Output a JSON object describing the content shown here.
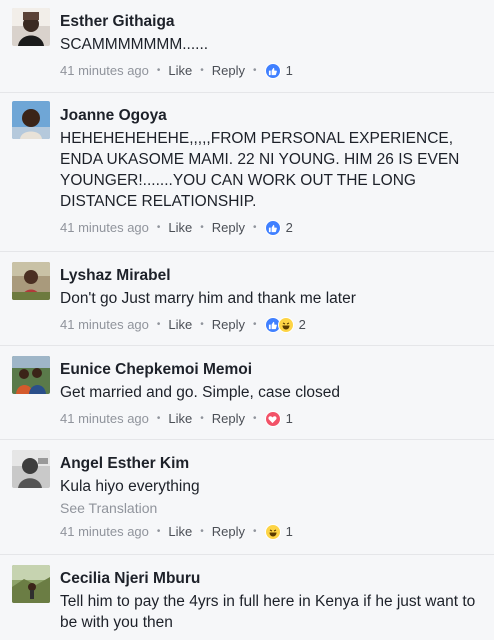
{
  "comments": [
    {
      "name": "Esther Githaiga",
      "text": "SCAMMMMMMM......",
      "time": "41 minutes ago",
      "like": "Like",
      "reply": "Reply",
      "reactions": [
        "like"
      ],
      "count": "1",
      "see_translation": ""
    },
    {
      "name": "Joanne Ogoya",
      "text": "HEHEHEHEHEHE,,,,,FROM PERSONAL EXPERIENCE, ENDA UKASOME MAMI. 22 NI YOUNG. HIM 26 IS EVEN YOUNGER!.......YOU CAN WORK OUT THE LONG DISTANCE RELATIONSHIP.",
      "time": "41 minutes ago",
      "like": "Like",
      "reply": "Reply",
      "reactions": [
        "like"
      ],
      "count": "2",
      "see_translation": ""
    },
    {
      "name": "Lyshaz Mirabel",
      "text": "Don't go Just marry him and thank me later",
      "time": "41 minutes ago",
      "like": "Like",
      "reply": "Reply",
      "reactions": [
        "like",
        "haha"
      ],
      "count": "2",
      "see_translation": ""
    },
    {
      "name": "Eunice Chepkemoi Memoi",
      "text": "Get married and go. Simple, case closed",
      "time": "41 minutes ago",
      "like": "Like",
      "reply": "Reply",
      "reactions": [
        "love"
      ],
      "count": "1",
      "see_translation": ""
    },
    {
      "name": "Angel Esther Kim",
      "text": "Kula hiyo everything",
      "time": "41 minutes ago",
      "like": "Like",
      "reply": "Reply",
      "reactions": [
        "haha"
      ],
      "count": "1",
      "see_translation": "See Translation"
    },
    {
      "name": "Cecilia Njeri Mburu",
      "text": "Tell him to pay the 4yrs in full here in Kenya if he just want to be with you then",
      "time": "",
      "like": "",
      "reply": "",
      "reactions": [],
      "count": "",
      "see_translation": ""
    }
  ],
  "colors": {
    "like": "#4080ff",
    "love": "#f25268",
    "haha": "#fdd446",
    "meta": "#90949c",
    "name": "#1d2129"
  },
  "icons": {
    "like": "thumbs-up-icon",
    "love": "heart-icon",
    "haha": "laughing-face-icon",
    "dot": "middle-dot"
  },
  "separator": "•"
}
